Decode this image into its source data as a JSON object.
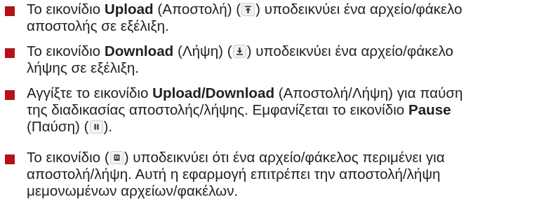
{
  "bullet_color": "#b4121a",
  "items": [
    {
      "l1_a": "Το εικονίδιο ",
      "l1_b": "Upload",
      "l1_c": " (Αποστολή) (",
      "icon": "upload-icon",
      "l1_d": ") υποδεικνύει ένα αρχείο/φάκελο",
      "l2": "αποστολής σε εξέλιξη."
    },
    {
      "l1_a": "Το εικονίδιο ",
      "l1_b": "Download",
      "l1_c": " (Λήψη) (",
      "icon": "download-icon",
      "l1_d": ") υποδεικνύει ένα αρχείο/φάκελο",
      "l2": "λήψης σε εξέλιξη."
    },
    {
      "l1_a": "Αγγίξτε το εικονίδιο ",
      "l1_b": "Upload/Download",
      "l1_c": " (Αποστολή/Λήψη) για παύση",
      "l2_a": "της διαδικασίας αποστολής/λήψης. Εμφανίζεται το εικονίδιο ",
      "l2_b": "Pause",
      "l3_a": "(Παύση) (",
      "icon": "pause-icon",
      "l3_b": ")."
    },
    {
      "l1_a": "Το εικονίδιο (",
      "icon": "waiting-icon",
      "l1_b": ") υποδεικνύει ότι ένα αρχείο/φάκελος περιμένει για",
      "l2": "αποστολή/λήψη. Αυτή η εφαρμογή επιτρέπει την αποστολή/λήψη",
      "l3": "μεμονωμένων αρχείων/φακέλων."
    }
  ]
}
